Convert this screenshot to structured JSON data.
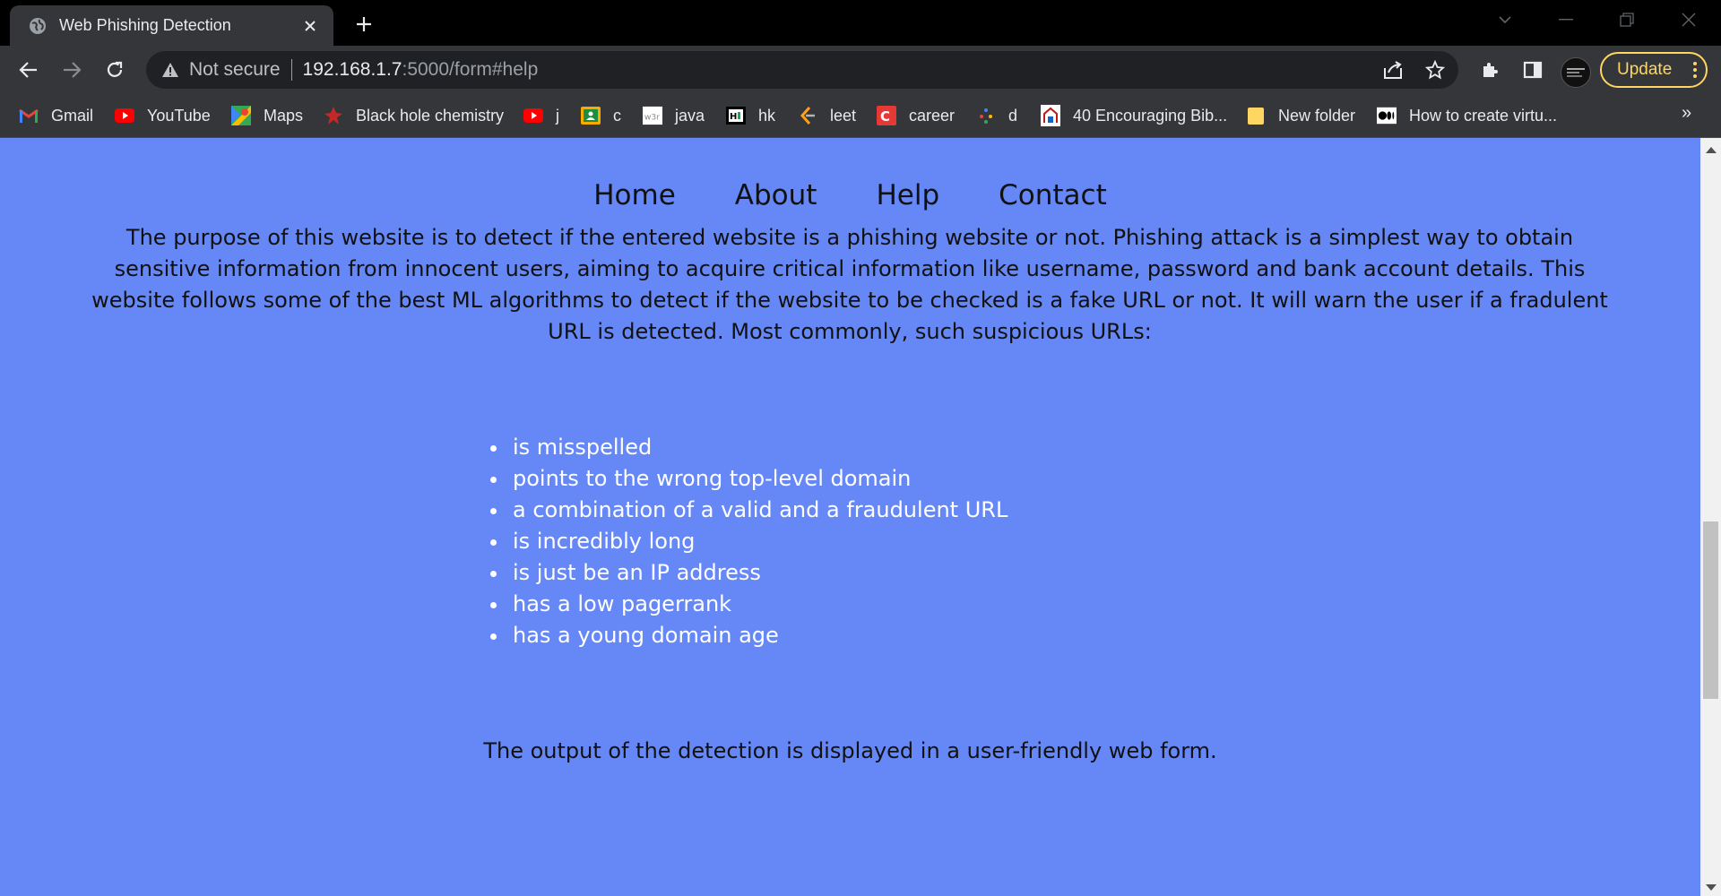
{
  "browser": {
    "tab_title": "Web Phishing Detection",
    "address": {
      "security_text": "Not secure",
      "host": "192.168.1.7",
      "path": ":5000/form#help"
    },
    "update_label": "Update",
    "bookmarks": [
      {
        "label": "Gmail",
        "icon": "gmail-icon",
        "color": "#ea4335"
      },
      {
        "label": "YouTube",
        "icon": "youtube-icon",
        "color": "#ff0000"
      },
      {
        "label": "Maps",
        "icon": "maps-icon",
        "color": "#34a853"
      },
      {
        "label": "Black hole chemistry",
        "icon": "blackhole-icon",
        "color": "#c62828"
      },
      {
        "label": "j",
        "icon": "youtube-icon",
        "color": "#ff0000"
      },
      {
        "label": "c",
        "icon": "classroom-icon",
        "color": "#f9ab00"
      },
      {
        "label": "java",
        "icon": "w3schools-icon",
        "color": "#ffffff"
      },
      {
        "label": "hk",
        "icon": "hackerrank-icon",
        "color": "#000000"
      },
      {
        "label": "leet",
        "icon": "leetcode-icon",
        "color": "#ffa116"
      },
      {
        "label": "career",
        "icon": "careercup-icon",
        "color": "#e53935"
      },
      {
        "label": "d",
        "icon": "dots-icon",
        "color": "#4285f4"
      },
      {
        "label": "40 Encouraging Bib...",
        "icon": "page-icon",
        "color": "#ffffff"
      },
      {
        "label": "New folder",
        "icon": "folder-icon",
        "color": "#fdd663"
      },
      {
        "label": "How to create virtu...",
        "icon": "medium-icon",
        "color": "#ffffff"
      }
    ]
  },
  "site": {
    "background_color": "#6688f7",
    "nav": [
      "Home",
      "About",
      "Help",
      "Contact"
    ],
    "intro": "The purpose of this website is to detect if the entered website is a phishing website or not. Phishing attack is a simplest way to obtain sensitive information from innocent users, aiming to acquire critical information like username, password and bank account details. This website follows some of the best ML algorithms to detect if the website to be checked is a fake URL or not. It will warn the user if a fradulent URL is detected. Most commonly, such suspicious URLs:",
    "reasons": [
      "is misspelled",
      "points to the wrong top-level domain",
      "a combination of a valid and a fraudulent URL",
      "is incredibly long",
      "is just be an IP address",
      "has a low pagerrank",
      "has a young domain age"
    ],
    "output_note": "The output of the detection is displayed in a user-friendly web form."
  }
}
